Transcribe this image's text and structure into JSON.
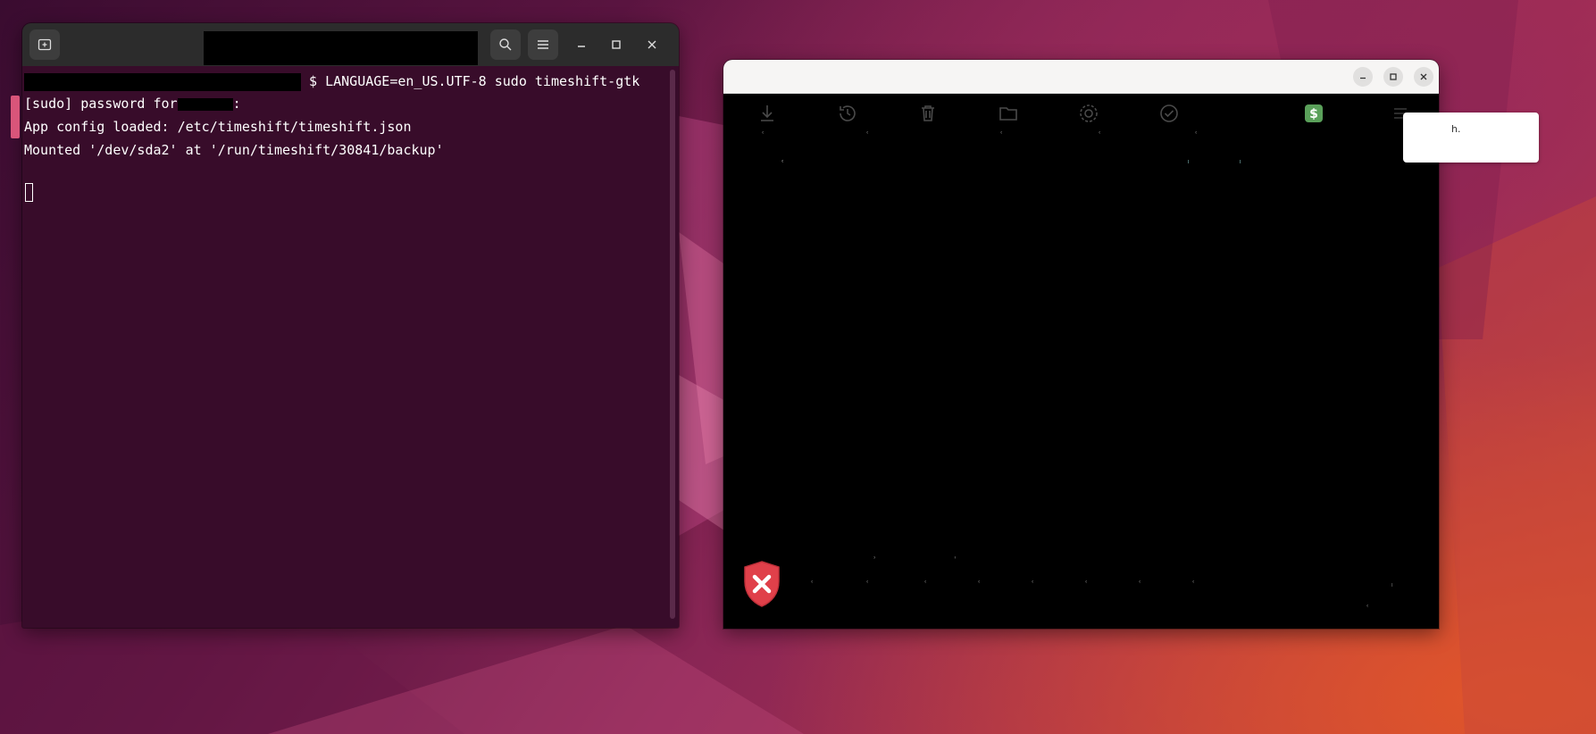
{
  "terminal": {
    "prompt_symbol": "$",
    "command": "LANGUAGE=en_US.UTF-8 sudo timeshift-gtk",
    "line2_prefix": "[sudo] password for",
    "line2_suffix": ":",
    "line3": "App config loaded: /etc/timeshift/timeshift.json",
    "line4": "Mounted '/dev/sda2' at '/run/timeshift/30841/backup'"
  },
  "timeshift": {
    "toolbar_icons": [
      "create-icon",
      "restore-icon",
      "delete-icon",
      "browse-icon",
      "settings-icon",
      "wizard-icon",
      "donate-icon",
      "menu-icon"
    ],
    "status_icon": "error-shield-icon"
  },
  "popup": {
    "text": "h."
  },
  "colors": {
    "terminal_bg": "#380c2a",
    "headerbar": "#2c2c2c",
    "error_red": "#e0404a",
    "donate_green": "#5aa05a"
  }
}
